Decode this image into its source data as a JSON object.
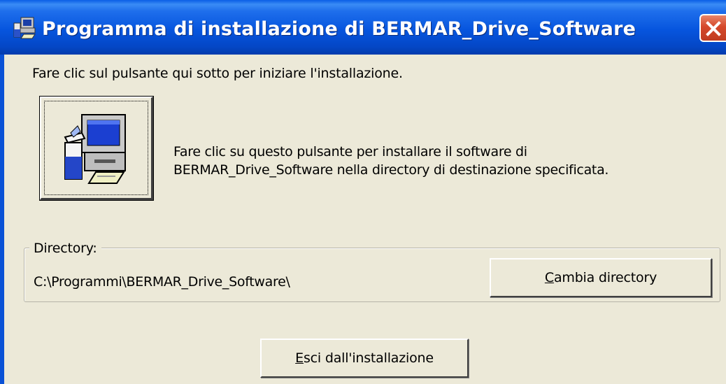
{
  "window": {
    "title": "Programma di installazione di BERMAR_Drive_Software",
    "title_icon": "setup-computer-icon",
    "close_icon": "close-icon"
  },
  "intro_text": "Fare clic sul pulsante qui sotto per iniziare l'installazione.",
  "install": {
    "icon": "install-computer-icon",
    "description_line1": "Fare clic su questo pulsante per installare il software di",
    "description_line2": "BERMAR_Drive_Software nella directory di destinazione specificata."
  },
  "directory": {
    "label": "Directory:",
    "path": "C:\\Programmi\\BERMAR_Drive_Software\\",
    "change_button": {
      "mnemonic": "C",
      "rest": "ambia directory"
    }
  },
  "exit_button": {
    "mnemonic": "E",
    "rest": "sci dall'installazione"
  },
  "colors": {
    "titlebar": "#0655de",
    "dialog_bg": "#ece9d8",
    "close_button": "#d5482a"
  }
}
